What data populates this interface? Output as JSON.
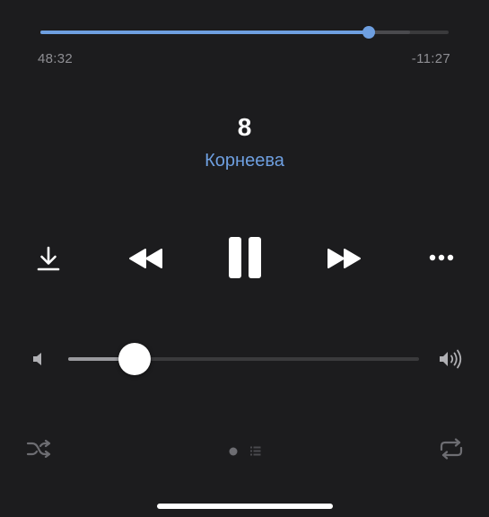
{
  "progress": {
    "elapsed": "48:32",
    "remaining": "-11:27",
    "played_fraction": 0.805,
    "buffered_fraction": 0.905
  },
  "track": {
    "title": "8",
    "artist": "Корнеева"
  },
  "controls": {
    "download_icon": "download-icon",
    "rewind_icon": "rewind-icon",
    "pause_icon": "pause-icon",
    "forward_icon": "fast-forward-icon",
    "more_icon": "more-icon"
  },
  "volume": {
    "level_fraction": 0.19
  },
  "bottom": {
    "shuffle_icon": "shuffle-icon",
    "repeat_icon": "repeat-icon",
    "active_page": 0,
    "page_count": 2
  },
  "colors": {
    "background": "#1c1c1e",
    "accent": "#6e9fe0",
    "secondary_text": "#8e8e93"
  }
}
